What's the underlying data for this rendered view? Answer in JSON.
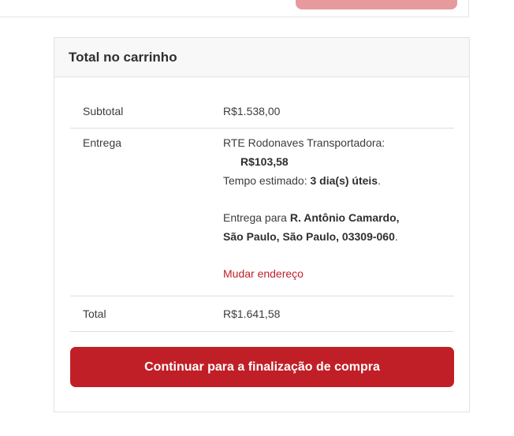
{
  "cart_totals": {
    "title": "Total no carrinho",
    "subtotal": {
      "label": "Subtotal",
      "value": "R$1.538,00"
    },
    "shipping": {
      "label": "Entrega",
      "method": "RTE Rodonaves Transportadora:",
      "price": "R$103,58",
      "estimate_prefix": "Tempo estimado:",
      "estimate_value": "3 dia(s) úteis",
      "estimate_suffix": ".",
      "destination_prefix": "Entrega para",
      "destination_line1": "R. Antônio Camardo,",
      "destination_line2": "São Paulo, São Paulo, 03309-060",
      "destination_suffix": ".",
      "change_address": "Mudar endereço"
    },
    "total": {
      "label": "Total",
      "value": "R$1.641,58"
    },
    "checkout_button": "Continuar para a finalização de compra"
  },
  "colors": {
    "accent": "#c11f27",
    "link": "#c0202a",
    "faded_button": "#e79a9e"
  }
}
